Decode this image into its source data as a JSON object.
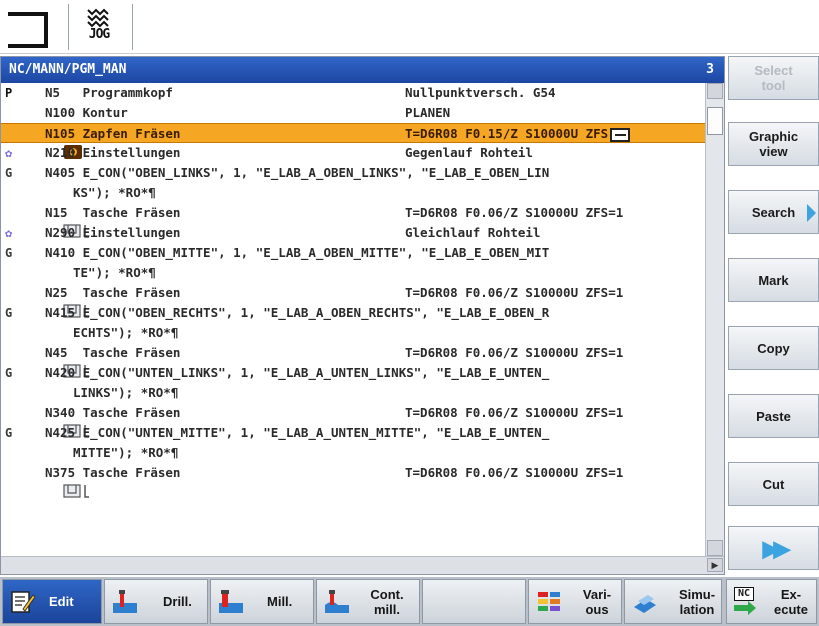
{
  "header": {
    "mode_label": "JOG"
  },
  "editor": {
    "path": "NC/MANN/PGM_MAN",
    "line_count": "3",
    "lines": [
      {
        "icon": "P",
        "col1": "N5   Programmkopf",
        "col2": "Nullpunktversch. G54"
      },
      {
        "icon": "contour",
        "col1": "N100 Kontur",
        "col2": "PLANEN"
      },
      {
        "icon": "mill",
        "col1": "N105 Zapfen Fräsen",
        "col2": "T=D6R08 F0.15/Z S10000U ZFS"
      },
      {
        "icon": "gear",
        "col1": "N210 Einstellungen",
        "col2": "Gegenlauf Rohteil"
      },
      {
        "icon": "G",
        "full": "N405 E_CON(\"OBEN_LINKS\", 1, \"E_LAB_A_OBEN_LINKS\", \"E_LAB_E_OBEN_LIN"
      },
      {
        "icon": "",
        "cont": "KS\"); *RO*¶"
      },
      {
        "icon": "pocket",
        "col1": "N15  Tasche Fräsen",
        "col2": "T=D6R08 F0.06/Z S10000U ZFS=1"
      },
      {
        "icon": "gear",
        "col1": "N290 Einstellungen",
        "col2": "Gleichlauf Rohteil"
      },
      {
        "icon": "G",
        "full": "N410 E_CON(\"OBEN_MITTE\", 1, \"E_LAB_A_OBEN_MITTE\", \"E_LAB_E_OBEN_MIT"
      },
      {
        "icon": "",
        "cont": "TE\"); *RO*¶"
      },
      {
        "icon": "pocket",
        "col1": "N25  Tasche Fräsen",
        "col2": "T=D6R08 F0.06/Z S10000U ZFS=1"
      },
      {
        "icon": "G",
        "full": "N415 E_CON(\"OBEN_RECHTS\", 1, \"E_LAB_A_OBEN_RECHTS\", \"E_LAB_E_OBEN_R"
      },
      {
        "icon": "",
        "cont": "ECHTS\"); *RO*¶"
      },
      {
        "icon": "pocket",
        "col1": "N45  Tasche Fräsen",
        "col2": "T=D6R08 F0.06/Z S10000U ZFS=1"
      },
      {
        "icon": "G",
        "full": "N420 E_CON(\"UNTEN_LINKS\", 1, \"E_LAB_A_UNTEN_LINKS\", \"E_LAB_E_UNTEN_"
      },
      {
        "icon": "",
        "cont": "LINKS\"); *RO*¶"
      },
      {
        "icon": "pocket",
        "col1": "N340 Tasche Fräsen",
        "col2": "T=D6R08 F0.06/Z S10000U ZFS=1"
      },
      {
        "icon": "G",
        "full": "N425 E_CON(\"UNTEN_MITTE\", 1, \"E_LAB_A_UNTEN_MITTE\", \"E_LAB_E_UNTEN_"
      },
      {
        "icon": "",
        "cont": "MITTE\"); *RO*¶"
      },
      {
        "icon": "pocket",
        "col1": "N375 Tasche Fräsen",
        "col2": "T=D6R08 F0.06/Z S10000U ZFS=1"
      }
    ]
  },
  "softkeys_vertical": {
    "select_tool": "Select tool",
    "graphic_view": "Graphic view",
    "search": "Search",
    "mark": "Mark",
    "copy": "Copy",
    "paste": "Paste",
    "cut": "Cut"
  },
  "softkeys_horizontal": {
    "edit": "Edit",
    "drill": "Drill.",
    "mill": "Mill.",
    "cont_mill": "Cont. mill.",
    "various": "Vari- ous",
    "simulation": "Simu- lation",
    "execute": "Ex- ecute",
    "nc_badge": "NC"
  },
  "colors": {
    "path_bar": "#1d46a2",
    "selected_line": "#f5a623",
    "active_softkey": "#2f66c6",
    "accent_arrow": "#3aa3e0"
  }
}
